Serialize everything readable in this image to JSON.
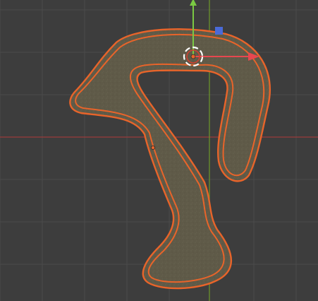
{
  "viewport": {
    "background_color": "#3d3d3d",
    "grid_color": "#4a4a4a",
    "x_axis_color": "#9a3c3c",
    "y_axis_color": "#6f9a2a"
  },
  "object": {
    "type": "curve-track-mesh",
    "selected": true,
    "outline_color": "#e8642a",
    "fill_color": "#5f5a48",
    "fill_texture_color": "#6b6652"
  },
  "gizmo": {
    "x_axis_color": "#e8474f",
    "y_axis_color": "#7ac943",
    "z_axis_color": "#4a6ad8",
    "center_color": "#e8642a",
    "ring_color": "#ffffff"
  },
  "icons": {
    "origin_point": "origin-point-icon",
    "cursor_3d": "3d-cursor-icon",
    "x_arrow": "x-axis-arrow-icon",
    "y_arrow": "y-axis-arrow-icon",
    "z_handle": "z-axis-handle-icon"
  }
}
